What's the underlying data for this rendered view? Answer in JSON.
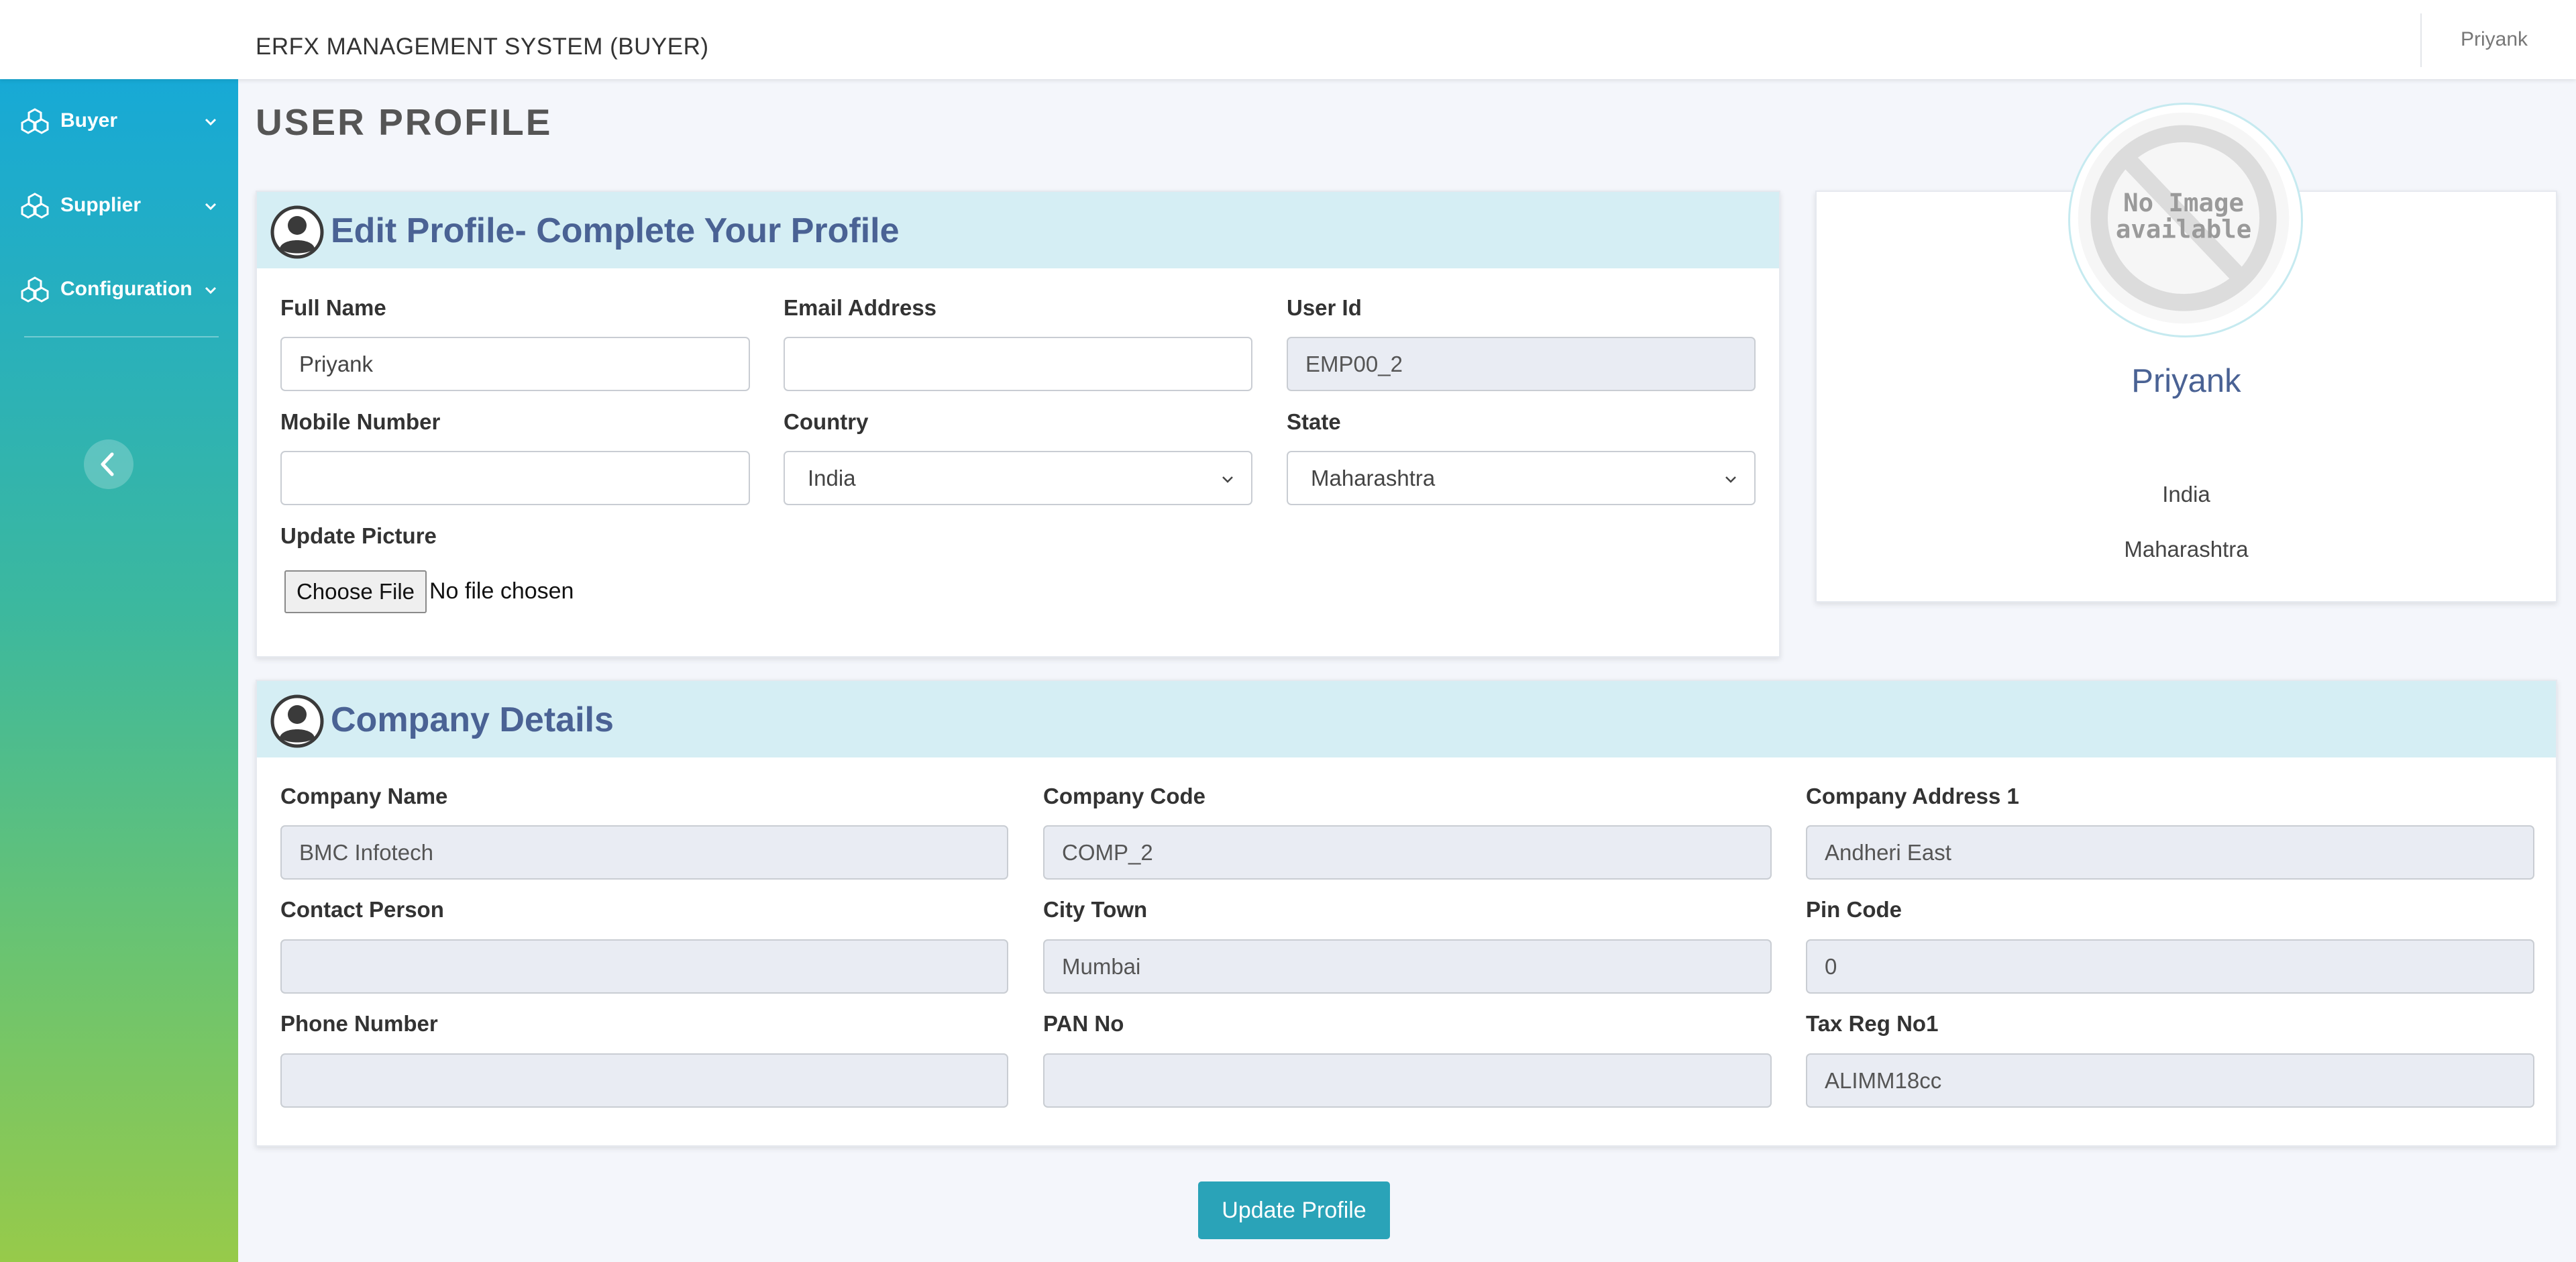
{
  "header": {
    "app_title": "ERFX MANAGEMENT SYSTEM (BUYER)",
    "user_name": "Priyank"
  },
  "sidebar": {
    "items": [
      {
        "label": "Buyer",
        "icon": "cubes-icon"
      },
      {
        "label": "Supplier",
        "icon": "cubes-icon"
      },
      {
        "label": "Configuration",
        "icon": "cubes-icon"
      }
    ],
    "collapse_icon": "chevron-left-icon"
  },
  "page": {
    "title": "USER PROFILE"
  },
  "edit_profile": {
    "title": "Edit Profile- Complete Your Profile",
    "full_name": {
      "label": "Full Name",
      "value": "Priyank"
    },
    "email": {
      "label": "Email Address",
      "value": ""
    },
    "user_id": {
      "label": "User Id",
      "value": "EMP00_2"
    },
    "mobile": {
      "label": "Mobile Number",
      "value": ""
    },
    "country": {
      "label": "Country",
      "value": "India"
    },
    "state": {
      "label": "State",
      "value": "Maharashtra"
    },
    "picture": {
      "label": "Update Picture",
      "button": "Choose File",
      "status": "No file chosen"
    }
  },
  "profile_card": {
    "image_text_line1": "No Image",
    "image_text_line2": "available",
    "name": "Priyank",
    "country": "India",
    "state": "Maharashtra"
  },
  "company": {
    "title": "Company Details",
    "company_name": {
      "label": "Company Name",
      "value": "BMC Infotech"
    },
    "company_code": {
      "label": "Company Code",
      "value": "COMP_2"
    },
    "address1": {
      "label": "Company Address 1",
      "value": "Andheri East"
    },
    "contact_person": {
      "label": "Contact Person",
      "value": ""
    },
    "city": {
      "label": "City Town",
      "value": "Mumbai"
    },
    "pin_code": {
      "label": "Pin Code",
      "value": "0"
    },
    "phone": {
      "label": "Phone Number",
      "value": ""
    },
    "pan": {
      "label": "PAN No",
      "value": ""
    },
    "tax_reg": {
      "label": "Tax Reg No1",
      "value": "ALIMM18cc"
    }
  },
  "actions": {
    "update_label": "Update Profile"
  },
  "colors": {
    "card_header_bg": "#d5eef4",
    "heading_text": "#4a6294",
    "primary_button": "#2aa3b8",
    "sidebar_top": "#17a9d6",
    "sidebar_bottom": "#97ca4a"
  }
}
